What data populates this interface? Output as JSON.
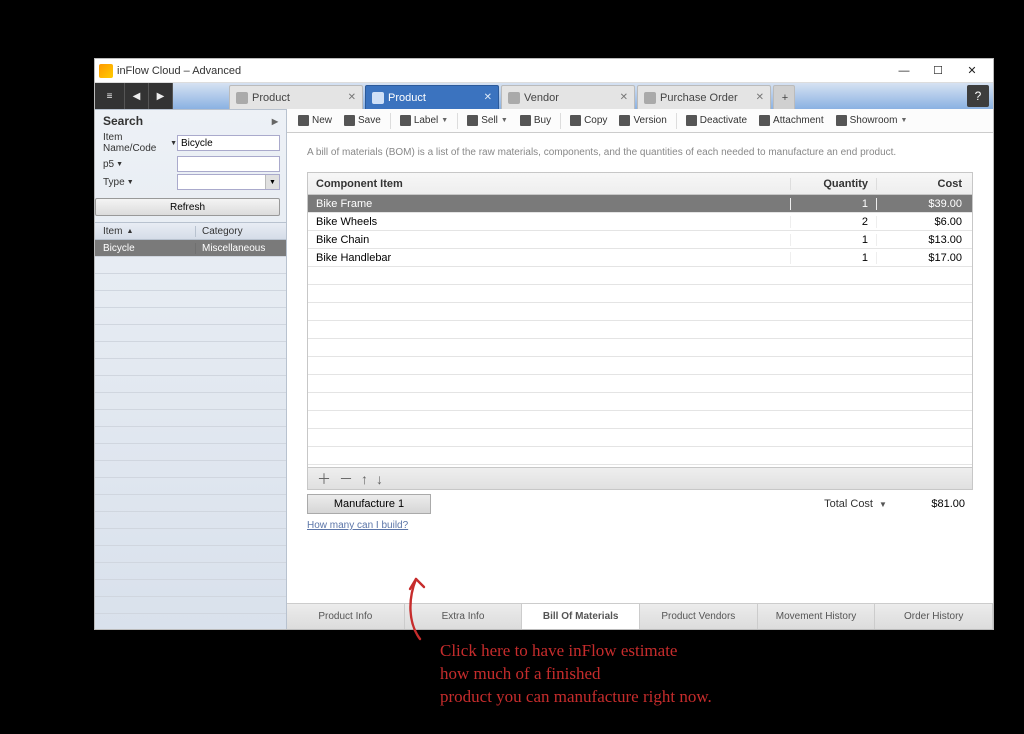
{
  "window": {
    "title": "inFlow Cloud – Advanced"
  },
  "tabs": [
    {
      "label": "Product",
      "active": false
    },
    {
      "label": "Product",
      "active": true
    },
    {
      "label": "Vendor",
      "active": false
    },
    {
      "label": "Purchase Order",
      "active": false
    }
  ],
  "sidebar": {
    "title": "Search",
    "filters": {
      "name_code_label": "Item Name/Code",
      "name_code_value": "Bicycle",
      "p5_label": "p5",
      "p5_value": "",
      "type_label": "Type",
      "type_value": ""
    },
    "refresh_label": "Refresh",
    "columns": {
      "item": "Item",
      "category": "Category"
    },
    "rows": [
      {
        "item": "Bicycle",
        "category": "Miscellaneous",
        "selected": true
      }
    ]
  },
  "toolbar": {
    "new": "New",
    "save": "Save",
    "label": "Label",
    "sell": "Sell",
    "buy": "Buy",
    "copy": "Copy",
    "version": "Version",
    "deactivate": "Deactivate",
    "attachment": "Attachment",
    "showroom": "Showroom"
  },
  "bom": {
    "description": "A bill of materials (BOM) is a list of the raw materials, components, and the quantities of each needed to manufacture an end product.",
    "columns": {
      "component": "Component Item",
      "quantity": "Quantity",
      "cost": "Cost"
    },
    "rows": [
      {
        "component": "Bike Frame",
        "quantity": "1",
        "cost": "$39.00",
        "selected": true
      },
      {
        "component": "Bike Wheels",
        "quantity": "2",
        "cost": "$6.00"
      },
      {
        "component": "Bike Chain",
        "quantity": "1",
        "cost": "$13.00"
      },
      {
        "component": "Bike Handlebar",
        "quantity": "1",
        "cost": "$17.00"
      }
    ],
    "manufacture_label": "Manufacture 1",
    "total_label": "Total Cost",
    "total_cost": "$81.00",
    "how_many_link": "How many can I build?"
  },
  "bottom_tabs": [
    "Product Info",
    "Extra Info",
    "Bill Of Materials",
    "Product Vendors",
    "Movement History",
    "Order History"
  ],
  "bottom_tabs_active": 2,
  "annotation": {
    "text": "Click here to have inFlow estimate\nhow much of a finished\nproduct you can manufacture right now."
  }
}
